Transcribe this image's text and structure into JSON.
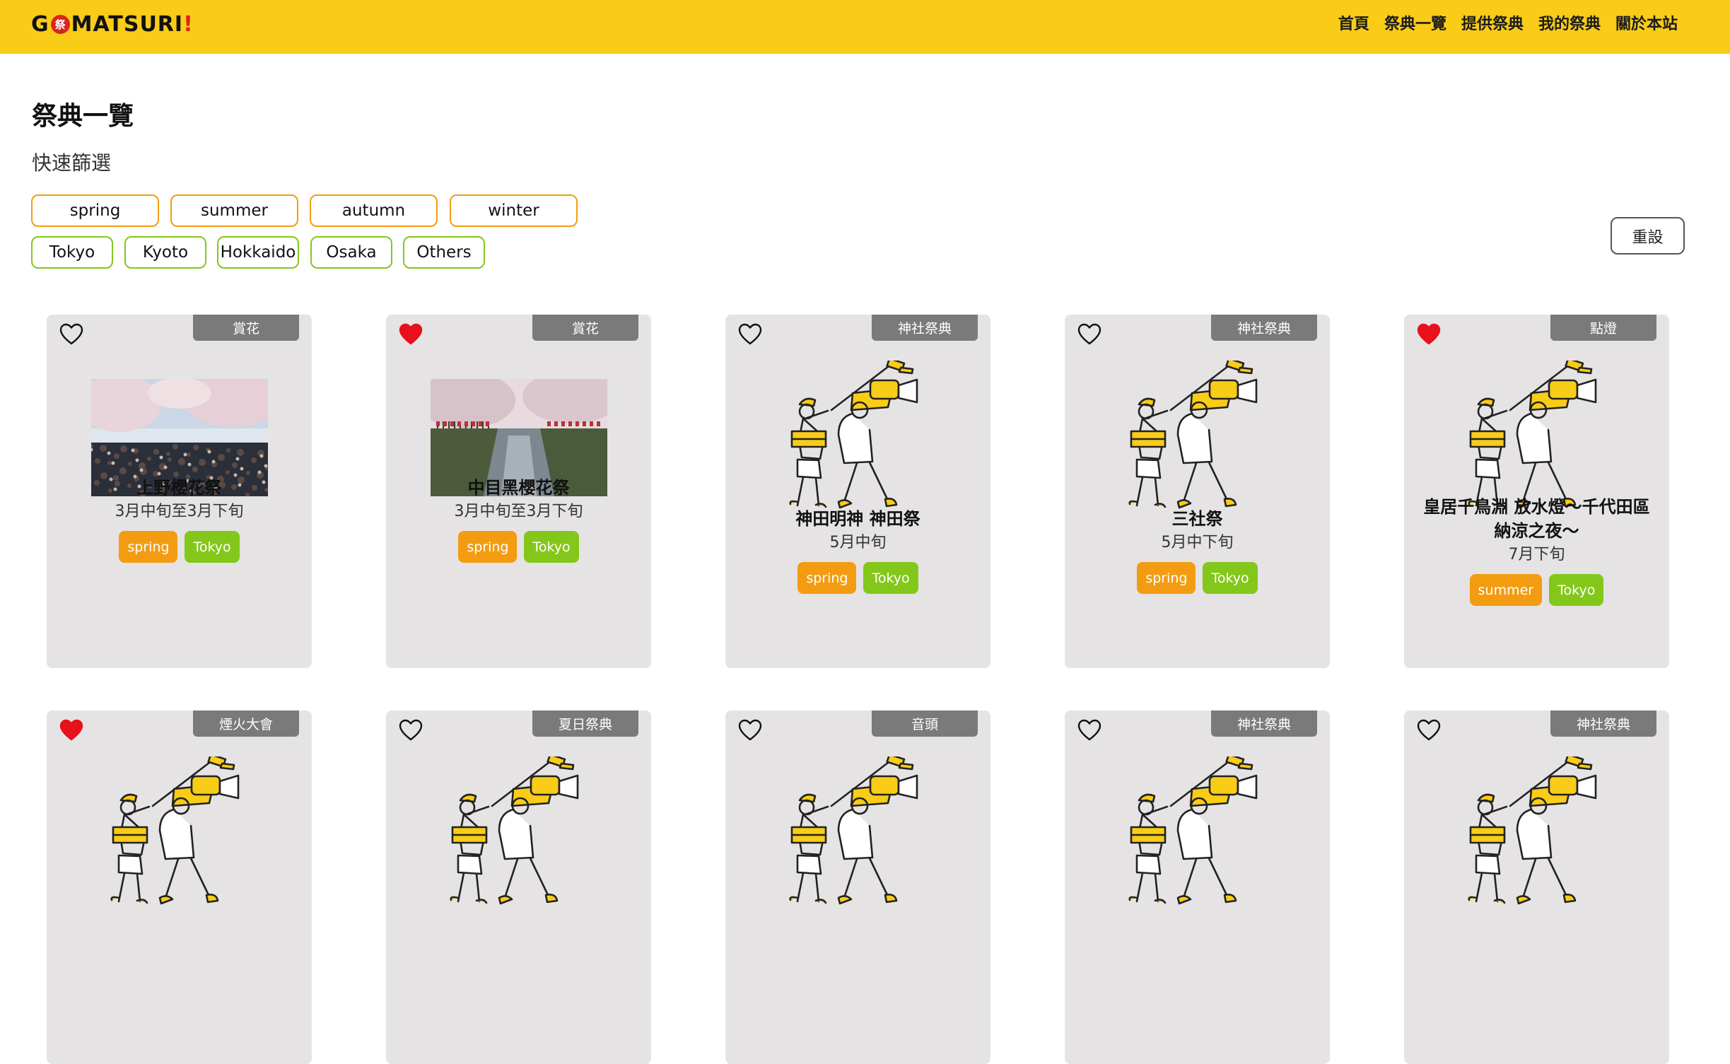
{
  "brand": {
    "logo_text_1": "G",
    "logo_seal": "祭",
    "logo_text_2": " MATSURI",
    "logo_bang": "!"
  },
  "nav": {
    "links": [
      "首頁",
      "祭典一覽",
      "提供祭典",
      "我的祭典",
      "關於本站"
    ]
  },
  "page": {
    "title": "祭典一覽",
    "filter_title": "快速篩選"
  },
  "filters": {
    "seasons": [
      "spring",
      "summer",
      "autumn",
      "winter"
    ],
    "regions": [
      "Tokyo",
      "Kyoto",
      "Hokkaido",
      "Osaka",
      "Others"
    ],
    "reset_label": "重設"
  },
  "colors": {
    "brand_yellow": "#f8cc17",
    "season_orange": "#f39c12",
    "region_green": "#84c71b",
    "favorite_red": "#e8101a",
    "category_gray": "#7a7a7a"
  },
  "festivals": [
    {
      "category": "賞花",
      "name": "上野櫻花祭",
      "date": "3月中旬至3月下旬",
      "season": "spring",
      "region": "Tokyo",
      "favorite": false,
      "image": "photo-ueno-sakura"
    },
    {
      "category": "賞花",
      "name": "中目黑櫻花祭",
      "date": "3月中旬至3月下旬",
      "season": "spring",
      "region": "Tokyo",
      "favorite": true,
      "image": "photo-meguro-river"
    },
    {
      "category": "神社祭典",
      "name": "神田明神 神田祭",
      "date": "5月中旬",
      "season": "spring",
      "region": "Tokyo",
      "favorite": false,
      "image": "illustration-film-crew"
    },
    {
      "category": "神社祭典",
      "name": "三社祭",
      "date": "5月中下旬",
      "season": "spring",
      "region": "Tokyo",
      "favorite": false,
      "image": "illustration-film-crew"
    },
    {
      "category": "點燈",
      "name": "皇居千鳥淵 放水燈～千代田區納涼之夜～",
      "date": "7月下旬",
      "season": "summer",
      "region": "Tokyo",
      "favorite": true,
      "image": "illustration-film-crew"
    },
    {
      "category": "煙火大會",
      "favorite": true,
      "image": "illustration-film-crew"
    },
    {
      "category": "夏日祭典",
      "favorite": false,
      "image": "illustration-film-crew"
    },
    {
      "category": "音頭",
      "favorite": false,
      "image": "illustration-film-crew"
    },
    {
      "category": "神社祭典",
      "favorite": false,
      "image": "illustration-film-crew"
    },
    {
      "category": "神社祭典",
      "favorite": false,
      "image": "illustration-film-crew"
    }
  ]
}
